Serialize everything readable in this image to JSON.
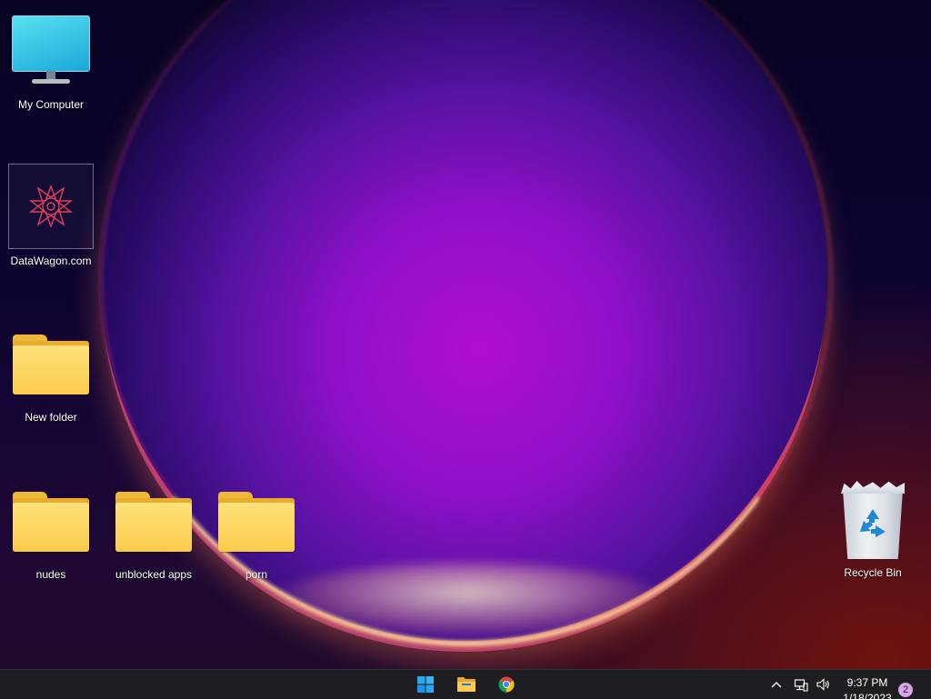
{
  "desktop": {
    "icons": [
      {
        "label": "My Computer",
        "icon": "monitor-icon"
      },
      {
        "label": "DataWagon.com",
        "icon": "datawagon-logo-icon"
      },
      {
        "label": "New folder",
        "icon": "folder-icon"
      },
      {
        "label": "nudes",
        "icon": "folder-icon"
      },
      {
        "label": "unblocked apps",
        "icon": "folder-icon"
      },
      {
        "label": "porn",
        "icon": "folder-icon"
      },
      {
        "label": "Recycle Bin",
        "icon": "recycle-bin-icon"
      }
    ]
  },
  "taskbar": {
    "pinned": [
      {
        "name": "Start",
        "icon": "windows-start-icon"
      },
      {
        "name": "File Explorer",
        "icon": "file-explorer-icon"
      },
      {
        "name": "Google Chrome",
        "icon": "chrome-icon"
      }
    ],
    "tray": {
      "chevron_icon": "chevron-up-icon",
      "network_icon": "network-icon",
      "volume_icon": "volume-icon"
    },
    "clock": {
      "time": "9:37 PM",
      "date": "1/18/2023"
    },
    "notification_count": "2"
  },
  "colors": {
    "folder": "#fbcb4b",
    "taskbar": "#1e1e22",
    "notification_badge": "#d9a4ea"
  }
}
